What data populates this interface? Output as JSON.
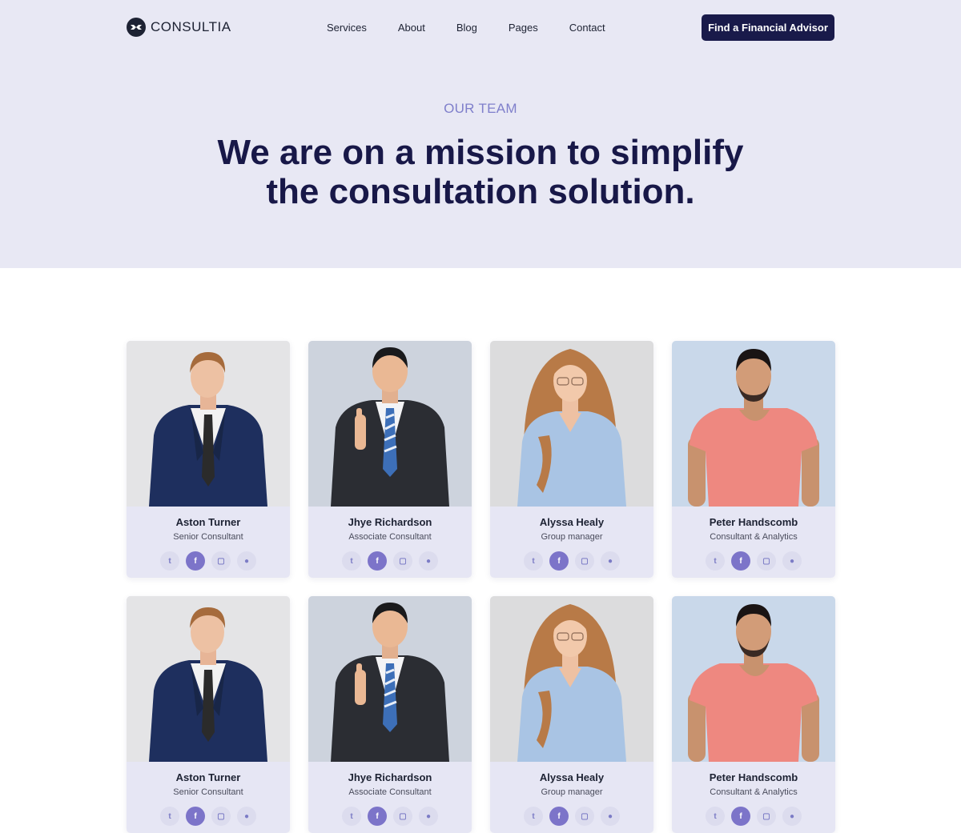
{
  "brand": {
    "name": "CONSULTIA"
  },
  "nav": {
    "links": [
      "Services",
      "About",
      "Blog",
      "Pages",
      "Contact"
    ],
    "cta": "Find a Financial Advisor"
  },
  "hero": {
    "eyebrow": "OUR TEAM",
    "headline_line1": "We are on a mission to simplify",
    "headline_line2": "the consultation solution."
  },
  "team": [
    {
      "name": "Aston Turner",
      "role": "Senior Consultant",
      "photo_bg": "#e4e4e6",
      "outfit": "navy-suit"
    },
    {
      "name": "Jhye Richardson",
      "role": "Associate Consultant",
      "photo_bg": "#cdd3dd",
      "outfit": "dark-suit"
    },
    {
      "name": "Alyssa Healy",
      "role": "Group manager",
      "photo_bg": "#dcdcdd",
      "outfit": "blue-shirt"
    },
    {
      "name": "Peter Handscomb",
      "role": "Consultant & Analytics",
      "photo_bg": "#c9d8ea",
      "outfit": "pink-tee"
    },
    {
      "name": "Aston Turner",
      "role": "Senior Consultant",
      "photo_bg": "#e4e4e6",
      "outfit": "navy-suit"
    },
    {
      "name": "Jhye Richardson",
      "role": "Associate Consultant",
      "photo_bg": "#cdd3dd",
      "outfit": "dark-suit"
    },
    {
      "name": "Alyssa Healy",
      "role": "Group manager",
      "photo_bg": "#dcdcdd",
      "outfit": "blue-shirt"
    },
    {
      "name": "Peter Handscomb",
      "role": "Consultant & Analytics",
      "photo_bg": "#c9d8ea",
      "outfit": "pink-tee"
    }
  ],
  "social_icons": [
    "twitter-icon",
    "facebook-icon",
    "instagram-icon",
    "github-icon"
  ],
  "colors": {
    "primary": "#191a4a",
    "accent": "#7c74c9",
    "hero_bg": "#e8e8f4",
    "card_bg": "#e6e6f4"
  }
}
